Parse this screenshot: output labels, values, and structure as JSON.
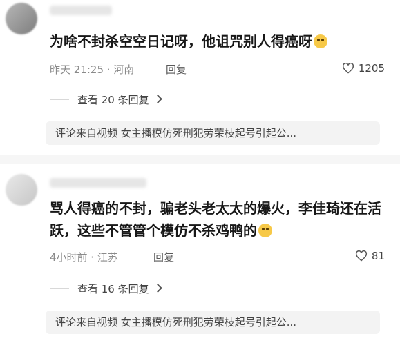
{
  "comments": [
    {
      "text": "为啥不封杀空空日记呀，他诅咒别人得癌呀",
      "meta": "昨天 21:25 · 河南",
      "reply_label": "回复",
      "likes": "1205",
      "view_replies": "查看 20 条回复",
      "source": "评论来自视频  女主播模仿死刑犯劳荣枝起号引起公..."
    },
    {
      "text": "骂人得癌的不封，骗老头老太太的爆火，李佳琦还在活跃，这些不管管个模仿不杀鸡鸭的",
      "meta": "4小时前 · 江苏",
      "reply_label": "回复",
      "likes": "81",
      "view_replies": "查看 16 条回复",
      "source": "评论来自视频  女主播模仿死刑犯劳荣枝起号引起公..."
    }
  ],
  "icons": {
    "like": "heart-outline-icon",
    "emoji1": "crying-face-icon",
    "emoji2": "drooling-face-icon",
    "chevron": "chevron-right-icon"
  },
  "colors": {
    "text": "#181818",
    "meta": "#8a8a8a",
    "source_bg": "#f3f3f3"
  }
}
